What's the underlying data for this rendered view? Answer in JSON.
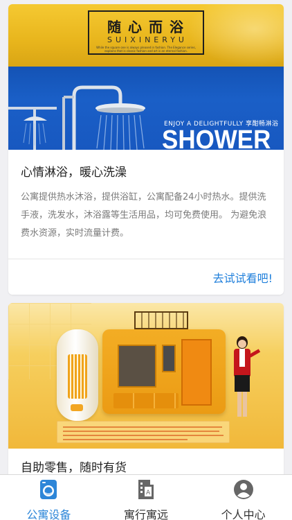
{
  "colors": {
    "accent": "#2d86d8",
    "link": "#1f7fdb",
    "tab_inactive": "#333333",
    "desc_text": "#7a7a7a"
  },
  "feed": {
    "cards": [
      {
        "banner": {
          "title_cn": "随心而浴",
          "title_en": "SUIXINERYU",
          "title_small": "While the square one is always pleased in fashion. The Elegance series, explains that is classic fashion and art is an eternal fashion.",
          "tagline": "ENJOY A DELIGHTFULLY 享酣畅淋浴",
          "big_word": "SHOWER"
        },
        "title": "心情淋浴，暖心洗澡",
        "description": "公寓提供热水沐浴，提供浴缸，公寓配备24小时热水。提供洗手液，洗发水，沐浴露等生活用品，均可免费使用。 为避免浪费水资源，实时流量计费。",
        "action": "去试试看吧!"
      },
      {
        "banner": {
          "image": "vending-machine-banner"
        },
        "title": "自助零售，随时有货"
      }
    ]
  },
  "tabbar": {
    "tabs": [
      {
        "label": "公寓设备",
        "icon": "washing-machine-icon",
        "active": true
      },
      {
        "label": "寓行寓远",
        "icon": "apartment-building-icon",
        "active": false
      },
      {
        "label": "个人中心",
        "icon": "user-avatar-icon",
        "active": false
      }
    ]
  }
}
